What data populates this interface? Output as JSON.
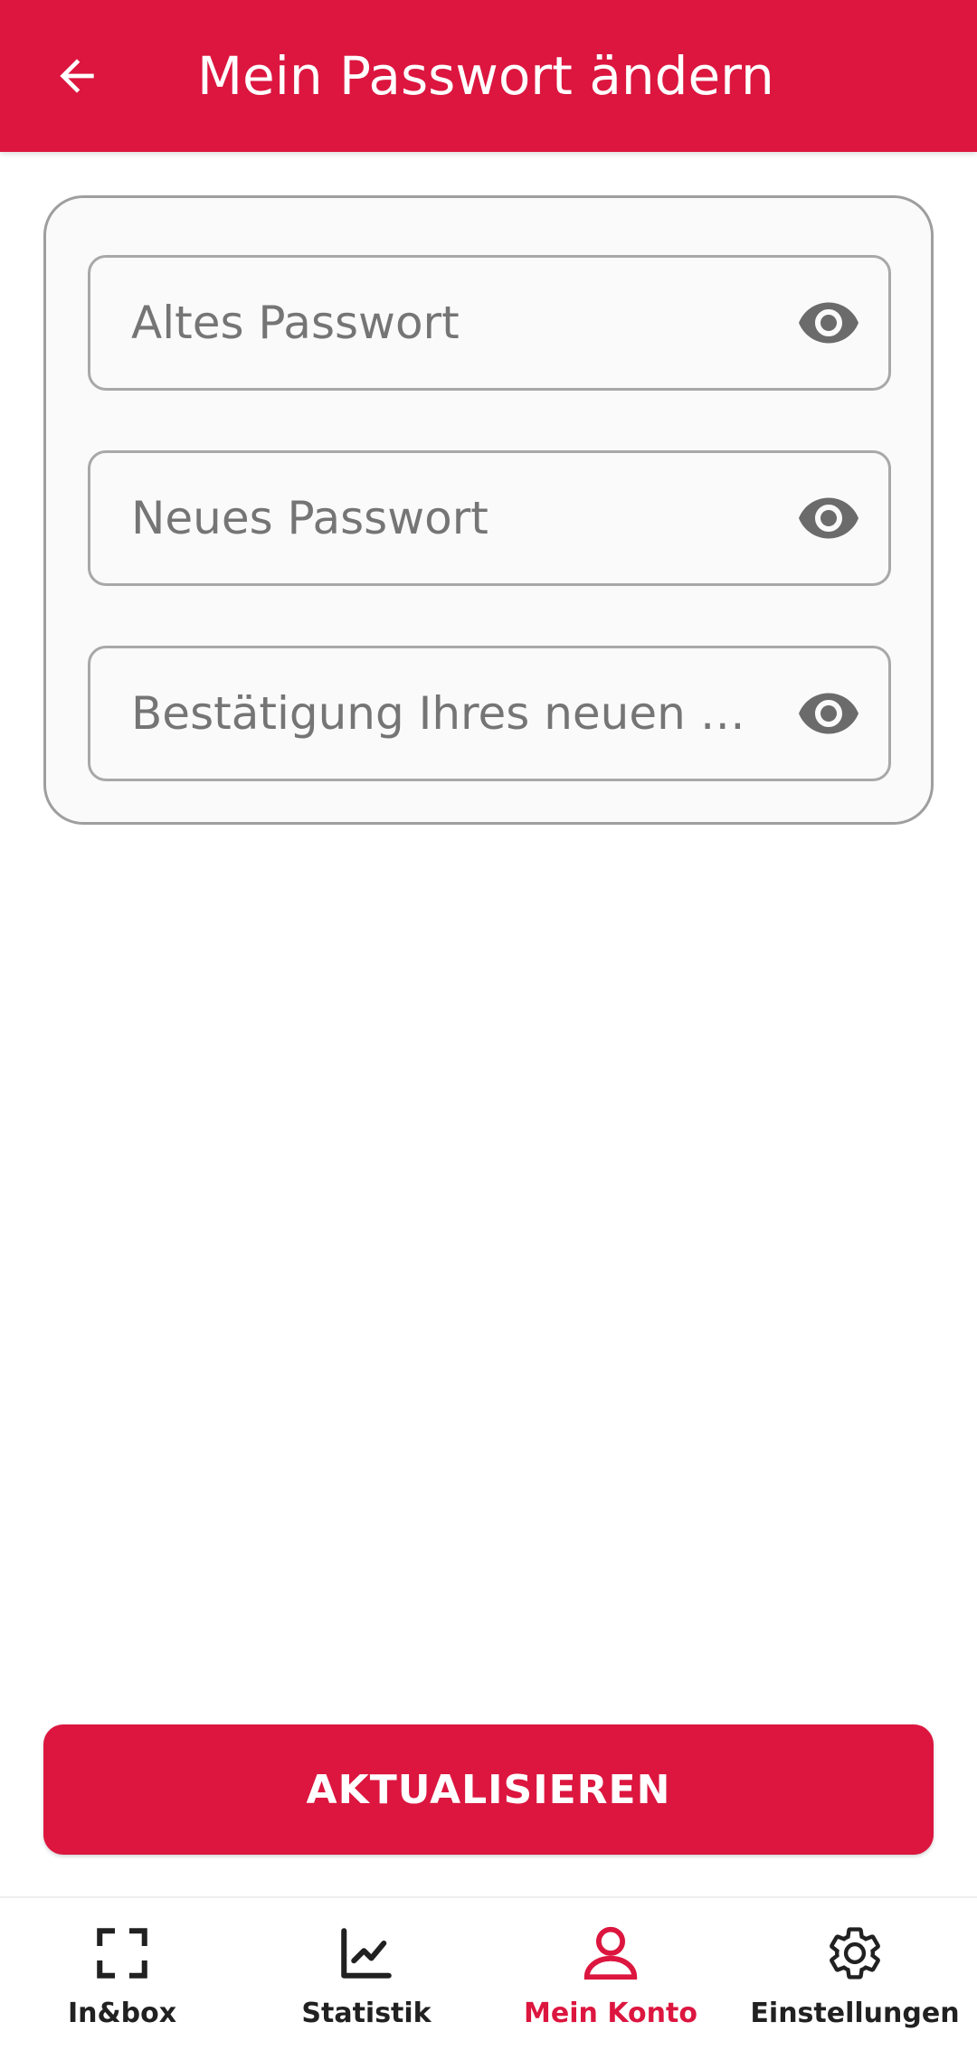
{
  "header": {
    "title": "Mein Passwort ändern",
    "back_icon": "arrow-left-icon"
  },
  "form": {
    "old_password": {
      "placeholder": "Altes Passwort",
      "value": ""
    },
    "new_password": {
      "placeholder": "Neues Passwort",
      "value": ""
    },
    "confirm_password": {
      "placeholder": "Bestätigung Ihres neuen Passworts",
      "value": ""
    },
    "visibility_icon": "eye-icon"
  },
  "submit": {
    "label": "AKTUALISIEREN"
  },
  "bottom_nav": {
    "items": [
      {
        "label": "In&box",
        "icon": "scan-frame-icon",
        "active": false
      },
      {
        "label": "Statistik",
        "icon": "line-chart-icon",
        "active": false
      },
      {
        "label": "Mein Konto",
        "icon": "user-icon",
        "active": true
      },
      {
        "label": "Einstellungen",
        "icon": "gear-icon",
        "active": false
      }
    ]
  },
  "colors": {
    "primary": "#dc163f",
    "card_border": "#9e9e9e",
    "icon_gray": "#6b6b6b",
    "text_dark": "#212121"
  }
}
